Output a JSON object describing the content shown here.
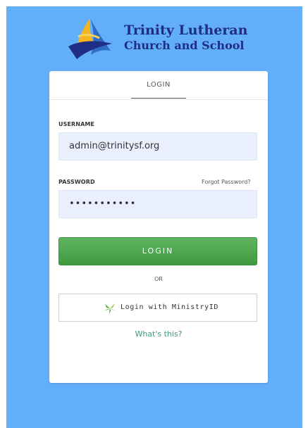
{
  "brand": {
    "line1": "Trinity Lutheran",
    "line2": "Church and School",
    "colors": {
      "navy": "#1e2e84",
      "gold": "#f4b41f",
      "blue": "#2f6bc4",
      "background": "#63aef8"
    }
  },
  "card": {
    "tab_label": "LOGIN",
    "username": {
      "label": "USERNAME",
      "value": "admin@trinitysf.org"
    },
    "password": {
      "label": "PASSWORD",
      "value": "•••••••••••",
      "forgot_label": "Forgot Password?"
    },
    "login_button": "LOGIN",
    "or_text": "OR",
    "ministry_button": {
      "label": "Login with MinistryID",
      "icon": "ministryid-leaf-icon"
    },
    "whats_this": "What's this?"
  },
  "colors": {
    "button_green": "#4aa84a",
    "link_green": "#3f9a76",
    "field_bg": "#e9effc"
  }
}
